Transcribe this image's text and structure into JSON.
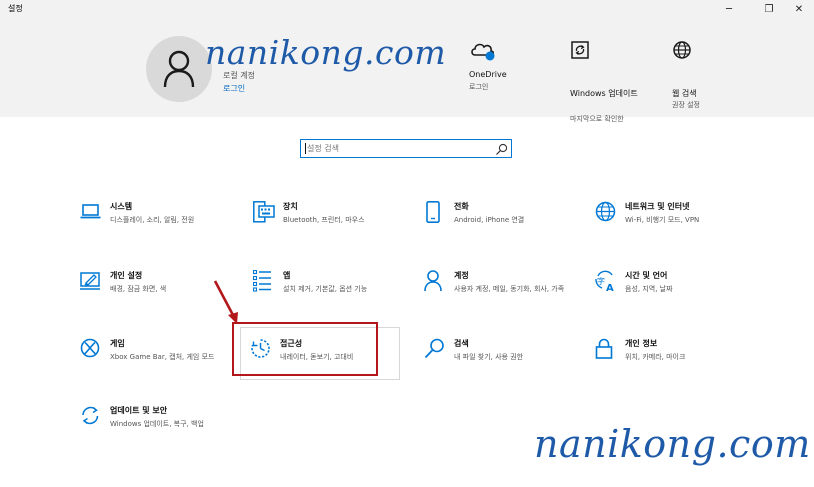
{
  "window": {
    "title": "설정",
    "minimize_glyph": "─",
    "restore_glyph": "❐",
    "close_glyph": "✕"
  },
  "account": {
    "line1": "로컬 계정",
    "line2": "로그인"
  },
  "watermark": "nanikong.com",
  "header_items": [
    {
      "id": "onedrive",
      "icon": "cloud-icon",
      "title": "OneDrive",
      "subtitle": "로그인"
    },
    {
      "id": "windows-update",
      "icon": "refresh-icon",
      "title": "Windows 업데이트",
      "subtitle": "마지막으로 확인한"
    },
    {
      "id": "web-search",
      "icon": "globe-icon",
      "title": "웹 검색",
      "subtitle": "권장 설정"
    }
  ],
  "search": {
    "placeholder": "설정 검색"
  },
  "tiles": [
    {
      "id": "system",
      "icon": "laptop-icon",
      "title": "시스템",
      "subtitle": "디스플레이, 소리, 알림, 전원"
    },
    {
      "id": "devices",
      "icon": "keyboard-icon",
      "title": "장치",
      "subtitle": "Bluetooth, 프린터, 마우스"
    },
    {
      "id": "phone",
      "icon": "phone-icon",
      "title": "전화",
      "subtitle": "Android, iPhone 연결"
    },
    {
      "id": "network",
      "icon": "globe-icon",
      "title": "네트워크 및 인터넷",
      "subtitle": "Wi-Fi, 비행기 모드, VPN"
    },
    {
      "id": "personalization",
      "icon": "paint-icon",
      "title": "개인 설정",
      "subtitle": "배경, 잠금 화면, 색"
    },
    {
      "id": "apps",
      "icon": "list-icon",
      "title": "앱",
      "subtitle": "설치 제거, 기본값, 옵션 기능"
    },
    {
      "id": "accounts",
      "icon": "person-icon",
      "title": "계정",
      "subtitle": "사용자 계정, 메일, 동기화, 회사, 가족"
    },
    {
      "id": "time-language",
      "icon": "language-icon",
      "title": "시간 및 언어",
      "subtitle": "음성, 지역, 날짜"
    },
    {
      "id": "gaming",
      "icon": "xbox-icon",
      "title": "게임",
      "subtitle": "Xbox Game Bar, 캡처, 게임 모드"
    },
    {
      "id": "accessibility",
      "icon": "accessibility-timer-icon",
      "title": "접근성",
      "subtitle": "내레이터, 돋보기, 고대비"
    },
    {
      "id": "search",
      "icon": "search-icon",
      "title": "검색",
      "subtitle": "내 파일 찾기, 사용 권한"
    },
    {
      "id": "privacy",
      "icon": "lock-icon",
      "title": "개인 정보",
      "subtitle": "위치, 카메라, 마이크"
    },
    {
      "id": "update-security",
      "icon": "update-icon",
      "title": "업데이트 및 보안",
      "subtitle": "Windows 업데이트, 복구, 백업"
    }
  ],
  "colors": {
    "accent": "#0078d4",
    "highlight": "#b3171b",
    "watermark": "#1e5aa8"
  }
}
